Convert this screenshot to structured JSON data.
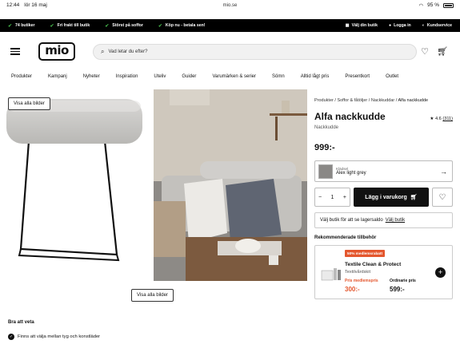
{
  "status": {
    "time": "12:44",
    "date": "lör 16 maj",
    "url": "mio.se",
    "battery": "95 %"
  },
  "usp": {
    "items": [
      "74 butiker",
      "Fri frakt till butik",
      "Störst på soffor",
      "Köp nu - betala sen!"
    ],
    "links": [
      "Välj din butik",
      "Logga in",
      "Kundservice"
    ]
  },
  "header": {
    "logo": "mio",
    "search_placeholder": "Vad letar du efter?"
  },
  "nav": [
    "Produkter",
    "Kampanj",
    "Nyheter",
    "Inspiration",
    "Uteliv",
    "Guider",
    "Varumärken & serier",
    "Sömn",
    "Alltid lågt pris",
    "Presentkort",
    "Outlet"
  ],
  "gallery": {
    "show_all_top": "Visa alla bilder",
    "show_all_bottom": "Visa alla bilder"
  },
  "product": {
    "breadcrumb": [
      "Produkter",
      "Soffor & fåtöljer",
      "Nackkuddar",
      "Alfa nackkudde"
    ],
    "title": "Alfa nackkudde",
    "rating": "4.6",
    "reviews": "(311)",
    "type": "Nackkudde",
    "price": "999:-",
    "variant_label": "Klädsel",
    "variant_value": "Alex light grey",
    "quantity": "1",
    "add_to_cart": "Lägg i varukorg",
    "stock_text": "Välj butik för att se lagersaldo",
    "stock_link": "Välj butik"
  },
  "recommended": {
    "heading": "Rekommenderade tillbehör",
    "badge": "50% medlemsrabatt",
    "name": "Textile Clean & Protect",
    "subtitle": "Textilvårdskit",
    "member_label": "Pris medlemspris",
    "member_price": "300:-",
    "ordinary_label": "Ordinarie pris",
    "ordinary_price": "599:-"
  },
  "bra": {
    "heading": "Bra att veta",
    "item": "Finns att välja mellan tyg och konstläder"
  }
}
